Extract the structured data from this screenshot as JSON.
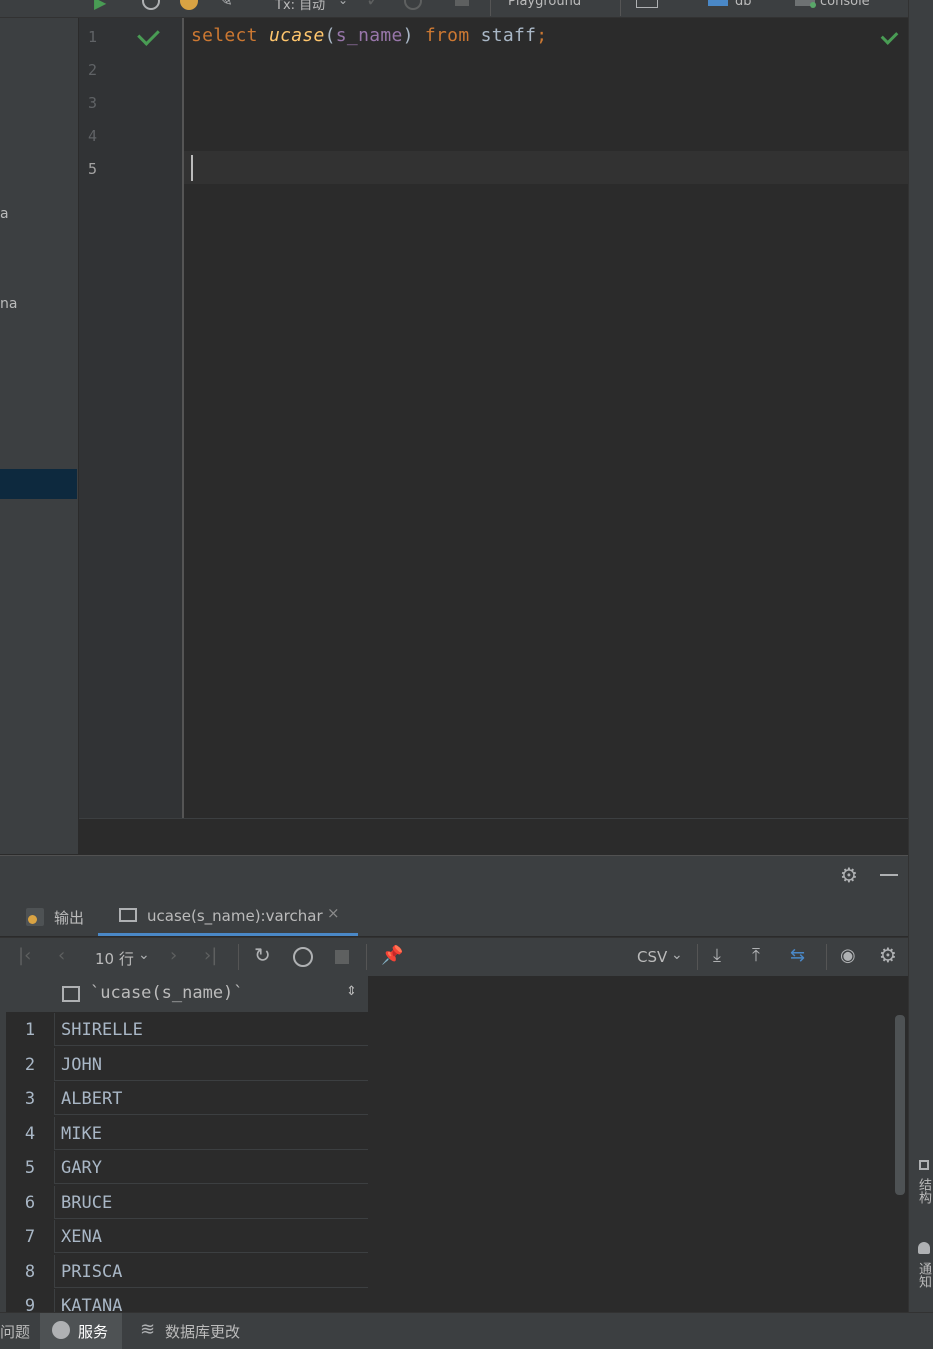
{
  "toolbar": {
    "tx_label": "Tx: 自动",
    "playground_label": "Playground",
    "db_label": "db",
    "console_label": "console"
  },
  "left_panel": {
    "fragment_1": "a",
    "fragment_2": "na"
  },
  "editor": {
    "line_numbers": [
      "1",
      "2",
      "3",
      "4",
      "5"
    ],
    "code": {
      "kw_select": "select",
      "fn_ucase": "ucase",
      "paren_open": "(",
      "col_s_name": "s_name",
      "paren_close": ")",
      "kw_from": "from",
      "table_staff": "staff",
      "semicolon": ";"
    }
  },
  "services": {
    "tabs": {
      "output_label": "输出",
      "result_label": "ucase(s_name):varchar"
    },
    "result_toolbar": {
      "rows_label": "10 行",
      "export_format": "CSV"
    },
    "grid": {
      "column_header": "`ucase(s_name)`",
      "rows": [
        {
          "num": "1",
          "value": "SHIRELLE"
        },
        {
          "num": "2",
          "value": "JOHN"
        },
        {
          "num": "3",
          "value": "ALBERT"
        },
        {
          "num": "4",
          "value": "MIKE"
        },
        {
          "num": "5",
          "value": "GARY"
        },
        {
          "num": "6",
          "value": "BRUCE"
        },
        {
          "num": "7",
          "value": "XENA"
        },
        {
          "num": "8",
          "value": "PRISCA"
        },
        {
          "num": "9",
          "value": "KATANA"
        }
      ]
    }
  },
  "right_strip": {
    "structure_label": "结构",
    "notifications_label": "通知"
  },
  "status_bar": {
    "problems_label": "问题",
    "services_label": "服务",
    "db_changes_label": "数据库更改"
  },
  "colors": {
    "keyword": "#cc7832",
    "function": "#ffc66d",
    "column": "#9876aa",
    "text": "#a9b7c6",
    "check_green": "#499c54",
    "accent_blue": "#4a88c7"
  }
}
